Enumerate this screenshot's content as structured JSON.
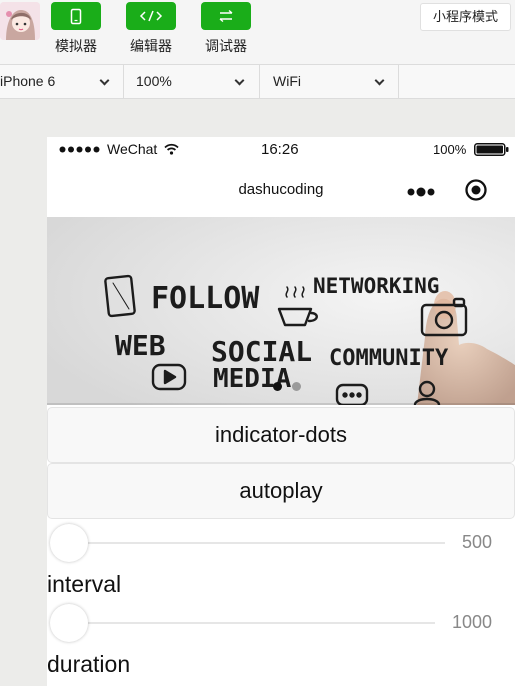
{
  "toolbar": {
    "simulator_label": "模拟器",
    "editor_label": "编辑器",
    "debugger_label": "调试器",
    "mode_label": "小程序模式"
  },
  "device_bar": {
    "device": "iPhone 6",
    "zoom": "100%",
    "network": "WiFi"
  },
  "status_bar": {
    "carrier": "WeChat",
    "time": "16:26",
    "battery": "100%",
    "battery_level": 1.0
  },
  "nav_bar": {
    "title": "dashucoding"
  },
  "banner": {
    "words": [
      "FOLLOW",
      "NETWORKING",
      "WEB",
      "SOCIAL",
      "MEDIA",
      "COMMUNITY"
    ],
    "indicator_dots": 2,
    "active_dot": 0
  },
  "buttons": {
    "indicator_dots": "indicator-dots",
    "autoplay": "autoplay"
  },
  "sliders": {
    "interval": {
      "label": "interval",
      "value": "500"
    },
    "duration": {
      "label": "duration",
      "value": "1000"
    }
  },
  "colors": {
    "accent": "#1aad19",
    "toolbar_bg": "#f5f5f5",
    "page_bg": "#ececea"
  }
}
